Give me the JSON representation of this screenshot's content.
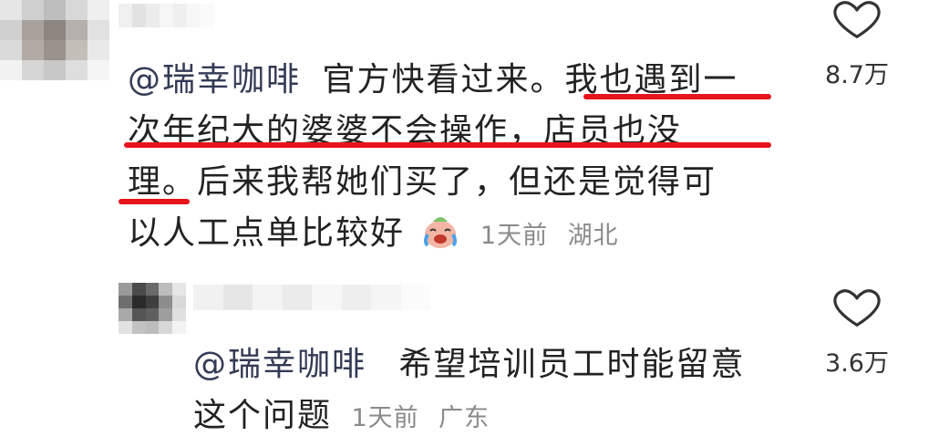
{
  "comments": [
    {
      "mention": "@瑞幸咖啡",
      "text_part1": "官方快看过来。",
      "text_line1_highlight": "我也遇到一",
      "line2": "次年纪大的婆婆不会操作，店员也没",
      "line3_start": "理",
      "line3_rest": "。后来我帮她们买了，但还是觉得可",
      "line4": "以人工点单比较好",
      "emoji": "crying-face-emoji",
      "time": "1天前",
      "location": "湖北",
      "likes": "8.7万"
    },
    {
      "mention": "@瑞幸咖啡",
      "text_part1": "希望培训员工时能留意",
      "line2": "这个问题",
      "time": "1天前",
      "location": "广东",
      "likes": "3.6万"
    }
  ],
  "icons": {
    "like": "heart-outline-icon"
  },
  "colors": {
    "underline": "#e8141b",
    "meta": "#8a8a8a",
    "mention": "#333b55"
  }
}
